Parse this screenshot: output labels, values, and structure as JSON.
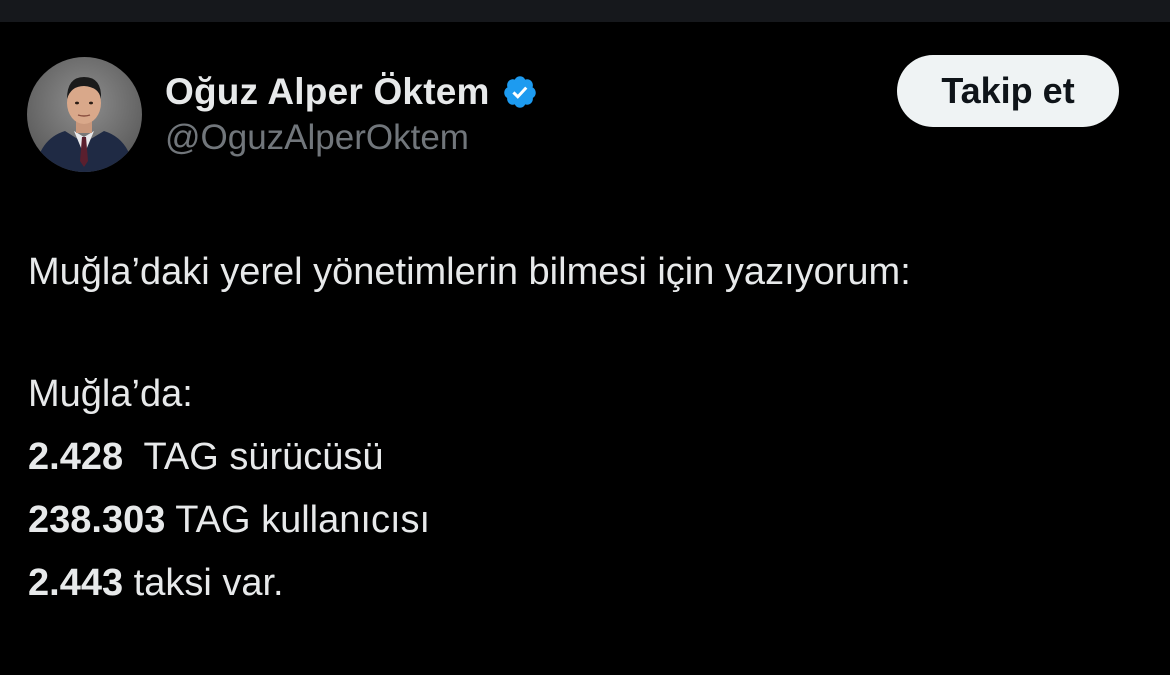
{
  "author": {
    "name": "Oğuz Alper Öktem",
    "handle": "@OguzAlperOktem",
    "verified": true
  },
  "follow_button": {
    "label": "Takip et"
  },
  "tweet": {
    "intro": "Muğla’daki yerel yönetimlerin bilmesi için yazıyorum:",
    "location_line": "Muğla’da:",
    "stats": [
      {
        "value": "2.428",
        "text": "  TAG sürücüsü"
      },
      {
        "value": "238.303",
        "text": " TAG kullanıcısı"
      },
      {
        "value": "2.443",
        "text": " taksi var."
      }
    ]
  },
  "colors": {
    "background": "#000000",
    "text_primary": "#e7e9ea",
    "text_secondary": "#71767b",
    "verified_blue": "#1d9bf0",
    "button_bg": "#eff3f4",
    "button_text": "#0f1419"
  }
}
